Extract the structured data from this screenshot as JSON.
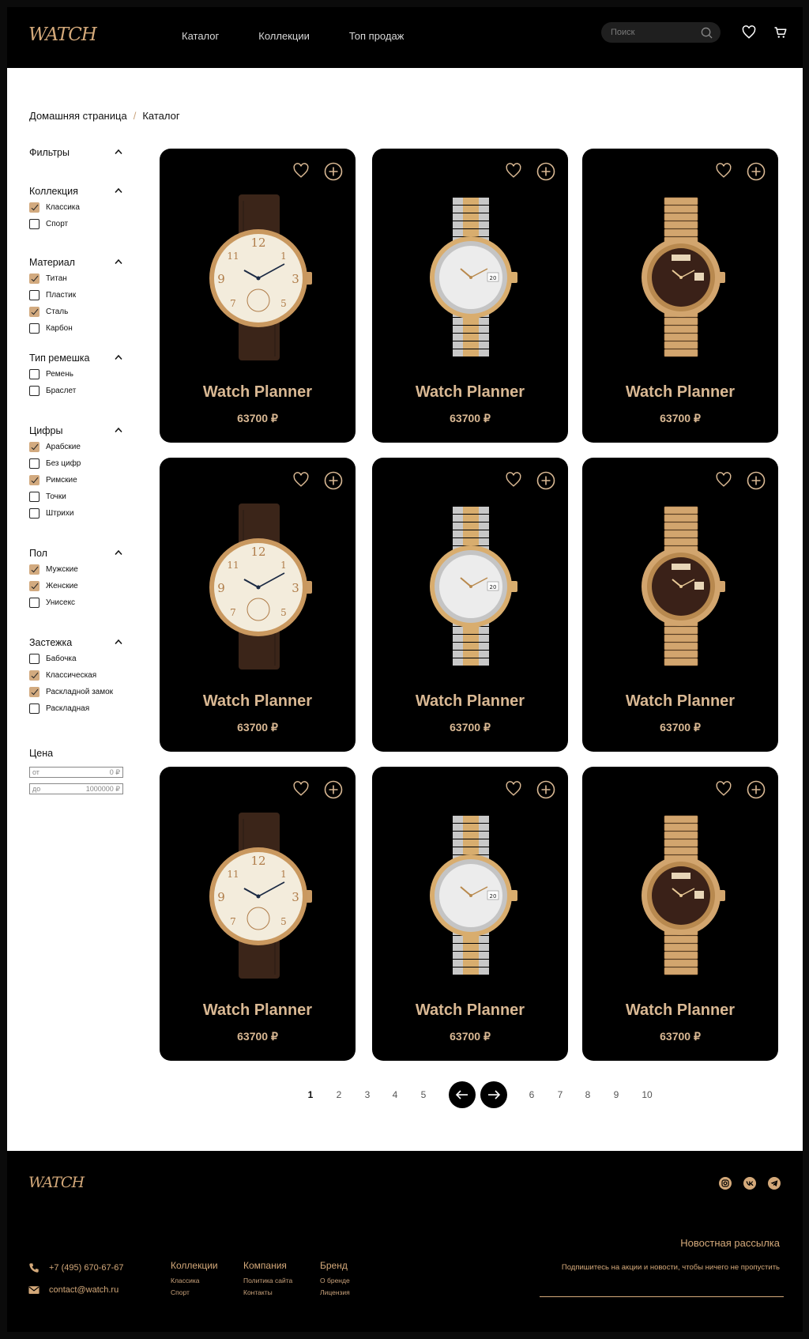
{
  "brand": "WATCH",
  "header": {
    "nav": [
      "Каталог",
      "Коллекции",
      "Топ продаж"
    ],
    "search_placeholder": "Поиск",
    "icons": [
      "search-icon",
      "heart-icon",
      "cart-icon"
    ]
  },
  "breadcrumb": [
    "Домашняя страница",
    "Каталог"
  ],
  "filters": {
    "title": "Фильтры",
    "groups": [
      {
        "title": "Коллекция",
        "options": [
          {
            "label": "Классика",
            "checked": true
          },
          {
            "label": "Спорт",
            "checked": false
          }
        ]
      },
      {
        "title": "Материал",
        "options": [
          {
            "label": "Титан",
            "checked": true
          },
          {
            "label": "Пластик",
            "checked": false
          },
          {
            "label": "Сталь",
            "checked": true
          },
          {
            "label": "Карбон",
            "checked": false
          }
        ]
      },
      {
        "title": "Тип ремешка",
        "options": [
          {
            "label": "Ремень",
            "checked": false
          },
          {
            "label": "Браслет",
            "checked": false
          }
        ]
      },
      {
        "title": "Цифры",
        "options": [
          {
            "label": "Арабские",
            "checked": true
          },
          {
            "label": "Без цифр",
            "checked": false
          },
          {
            "label": "Римские",
            "checked": true
          },
          {
            "label": "Точки",
            "checked": false
          },
          {
            "label": "Штрихи",
            "checked": false
          }
        ]
      },
      {
        "title": "Пол",
        "options": [
          {
            "label": "Мужские",
            "checked": true
          },
          {
            "label": "Женские",
            "checked": true
          },
          {
            "label": "Унисекс",
            "checked": false
          }
        ]
      },
      {
        "title": "Застежка",
        "options": [
          {
            "label": "Бабочка",
            "checked": false
          },
          {
            "label": "Классическая",
            "checked": true
          },
          {
            "label": "Раскладной замок",
            "checked": true
          },
          {
            "label": "Раскладная",
            "checked": false
          }
        ]
      }
    ],
    "price": {
      "title": "Цена",
      "from_label": "от",
      "from_value": "0 ₽",
      "to_label": "до",
      "to_value": "1000000 ₽"
    }
  },
  "products": [
    {
      "name": "Watch Planner",
      "price": "63700 ₽",
      "style": "leather"
    },
    {
      "name": "Watch Planner",
      "price": "63700 ₽",
      "style": "twotone"
    },
    {
      "name": "Watch Planner",
      "price": "63700 ₽",
      "style": "gold"
    },
    {
      "name": "Watch Planner",
      "price": "63700 ₽",
      "style": "leather"
    },
    {
      "name": "Watch Planner",
      "price": "63700 ₽",
      "style": "twotone"
    },
    {
      "name": "Watch Planner",
      "price": "63700 ₽",
      "style": "gold"
    },
    {
      "name": "Watch Planner",
      "price": "63700 ₽",
      "style": "leather"
    },
    {
      "name": "Watch Planner",
      "price": "63700 ₽",
      "style": "twotone"
    },
    {
      "name": "Watch Planner",
      "price": "63700 ₽",
      "style": "gold"
    }
  ],
  "pagination": {
    "current": "1",
    "pages_left": [
      "1",
      "2",
      "3",
      "4",
      "5"
    ],
    "pages_right": [
      "6",
      "7",
      "8",
      "9",
      "10"
    ]
  },
  "footer": {
    "phone": "+7 (495) 670-67-67",
    "email": "contact@watch.ru",
    "columns": [
      {
        "title": "Коллекции",
        "links": [
          "Классика",
          "Спорт"
        ]
      },
      {
        "title": "Компания",
        "links": [
          "Политика сайта",
          "Контакты"
        ]
      },
      {
        "title": "Бренд",
        "links": [
          "О бренде",
          "Лицензия"
        ]
      }
    ],
    "newsletter_title": "Новостная рассылка",
    "newsletter_text": "Подпишитесь на акции и новости, чтобы ничего не пропустить",
    "social": [
      "instagram-icon",
      "vk-icon",
      "telegram-icon"
    ]
  },
  "colors": {
    "accent": "#d4a97a",
    "background": "#000000",
    "surface": "#ffffff"
  }
}
